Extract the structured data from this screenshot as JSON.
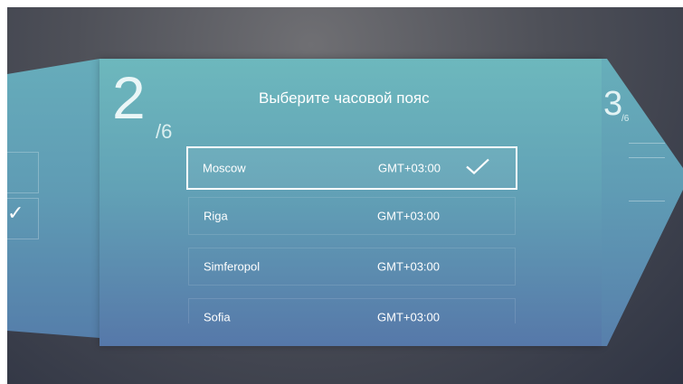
{
  "wizard": {
    "current_step": "2",
    "total_steps": "/6",
    "title": "Выберите часовой пояс"
  },
  "timezones": [
    {
      "city": "Moscow",
      "offset": "GMT+03:00",
      "selected": true
    },
    {
      "city": "Riga",
      "offset": "GMT+03:00",
      "selected": false
    },
    {
      "city": "Simferopol",
      "offset": "GMT+03:00",
      "selected": false
    },
    {
      "city": "Sofia",
      "offset": "GMT+03:00",
      "selected": false
    }
  ],
  "icons": {
    "selected_check": "checkmark-icon"
  },
  "next_panel": {
    "step": "3",
    "total": "/6"
  },
  "colors": {
    "panel_top": "#6db8bd",
    "panel_bottom": "#5678a9",
    "text": "#ffffff"
  }
}
